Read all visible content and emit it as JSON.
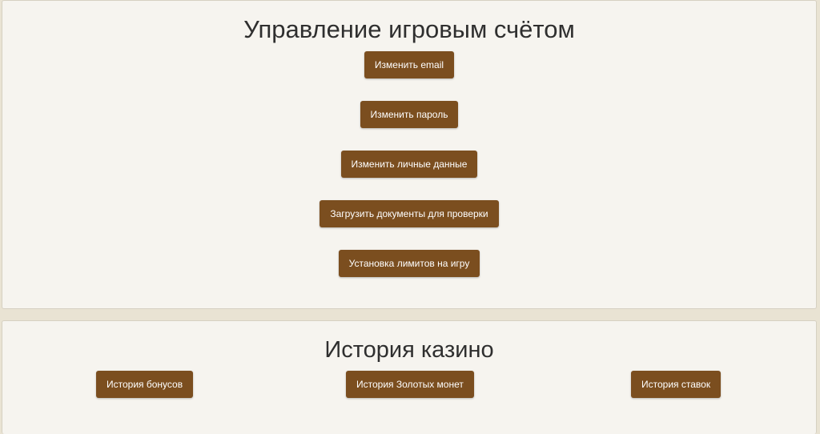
{
  "account": {
    "title": "Управление игровым счётом",
    "buttons": {
      "change_email": "Изменить email",
      "change_password": "Изменить пароль",
      "change_personal": "Изменить личные данные",
      "upload_docs": "Загрузить документы для проверки",
      "game_limits": "Установка лимитов на игру"
    }
  },
  "history": {
    "title": "История казино",
    "buttons": {
      "bonus": "История бонусов",
      "gold_coins": "История Золотых монет",
      "bets": "История ставок"
    }
  },
  "colors": {
    "button_bg": "#7b4e1f",
    "panel_bg": "#f6f4ef",
    "page_bg": "#e9e3d3"
  }
}
